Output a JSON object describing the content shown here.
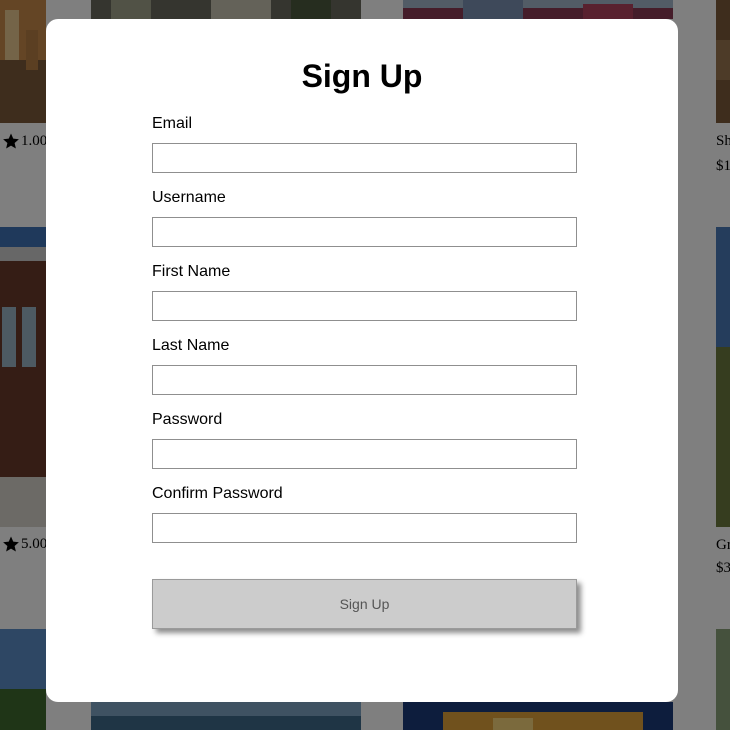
{
  "background": {
    "ratings": [
      "1.00",
      "5.00"
    ],
    "right_cards": [
      {
        "title": "Sh",
        "price": "$1"
      },
      {
        "title": "Gr",
        "price": "$3"
      }
    ]
  },
  "modal": {
    "title": "Sign Up",
    "fields": [
      {
        "label": "Email",
        "value": "",
        "type": "email"
      },
      {
        "label": "Username",
        "value": "",
        "type": "text"
      },
      {
        "label": "First Name",
        "value": "",
        "type": "text"
      },
      {
        "label": "Last Name",
        "value": "",
        "type": "text"
      },
      {
        "label": "Password",
        "value": "",
        "type": "password"
      },
      {
        "label": "Confirm Password",
        "value": "",
        "type": "password"
      }
    ],
    "submit_label": "Sign Up"
  }
}
